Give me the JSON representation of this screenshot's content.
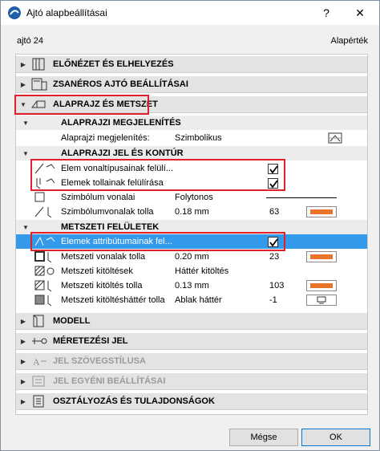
{
  "titlebar": {
    "title": "Ajtó alapbeállításai",
    "help": "?",
    "close": "✕"
  },
  "header": {
    "name": "ajtó 24",
    "preset": "Alapérték"
  },
  "sections": {
    "preview": "ELŐNÉZET ÉS ELHELYEZÉS",
    "hinged": "ZSANÉROS AJTÓ BEÁLLÍTÁSAI",
    "floorplan": "ALAPRAJZ ÉS METSZET",
    "model": "MODELL",
    "dimension": "MÉRETEZÉSI JEL",
    "textstyle": "JEL SZÖVEGSTÍLUSA",
    "custom": "JEL EGYÉNI BEÁLLÍTÁSAI",
    "classification": "OSZTÁLYOZÁS ÉS TULAJDONSÁGOK"
  },
  "subsections": {
    "display": "ALAPRAJZI MEGJELENÍTÉS",
    "symbol": "ALAPRAJZI JEL ÉS KONTÚR",
    "cut": "METSZETI FELÜLETEK"
  },
  "rows": {
    "display_mode": {
      "label": "Alaprajzi megjelenítés:",
      "value": "Szimbolikus"
    },
    "override_linetype": {
      "label": "Elem vonaltípusainak felülí..."
    },
    "override_pen": {
      "label": "Elemek tollainak felülírása"
    },
    "symbol_lines": {
      "label": "Szimbólum vonalai",
      "value": "Folytonos"
    },
    "symbol_pen": {
      "label": "Szimbólumvonalak tolla",
      "value": "0.18 mm",
      "num": "63"
    },
    "override_attr": {
      "label": "Elemek attribútumainak fel..."
    },
    "cut_line_pen": {
      "label": "Metszeti vonalak tolla",
      "value": "0.20 mm",
      "num": "23"
    },
    "cut_fills": {
      "label": "Metszeti kitöltések",
      "value": "Háttér kitöltés"
    },
    "cut_fill_pen": {
      "label": "Metszeti kitöltés tolla",
      "value": "0.13 mm",
      "num": "103"
    },
    "cut_bg_pen": {
      "label": "Metszeti kitöltésháttér tolla",
      "value": "Ablak háttér",
      "num": "-1"
    }
  },
  "colors": {
    "pen_orange": "#e8742a",
    "selection": "#3399ea",
    "highlight_red": "#e0202a"
  },
  "footer": {
    "cancel": "Mégse",
    "ok": "OK"
  }
}
